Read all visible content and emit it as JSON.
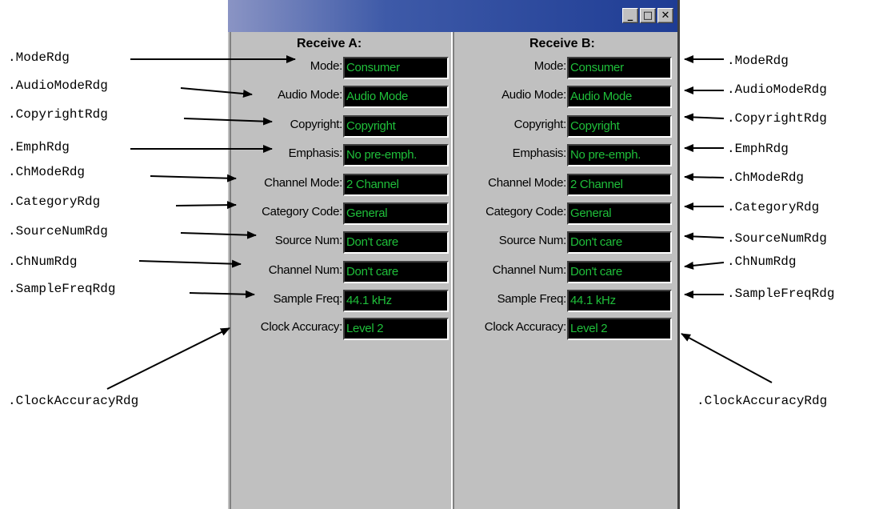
{
  "window": {
    "controls": {
      "minimize": "_",
      "maximize": "□",
      "close": "✕"
    }
  },
  "receive_a": {
    "header": "Receive A:",
    "fields": [
      {
        "label": "Mode:",
        "value": "Consumer"
      },
      {
        "label": "Audio Mode:",
        "value": "Audio Mode"
      },
      {
        "label": "Copyright:",
        "value": "Copyright"
      },
      {
        "label": "Emphasis:",
        "value": "No pre-emph."
      },
      {
        "label": "Channel Mode:",
        "value": "2 Channel"
      },
      {
        "label": "Category Code:",
        "value": "General"
      },
      {
        "label": "Source Num:",
        "value": "Don't care"
      },
      {
        "label": "Channel Num:",
        "value": "Don't care"
      },
      {
        "label": "Sample Freq:",
        "value": "44.1 kHz"
      },
      {
        "label": "Clock Accuracy:",
        "value": "Level 2"
      }
    ]
  },
  "receive_b": {
    "header": "Receive B:",
    "fields": [
      {
        "label": "Mode:",
        "value": "Consumer"
      },
      {
        "label": "Audio Mode:",
        "value": "Audio Mode"
      },
      {
        "label": "Copyright:",
        "value": "Copyright"
      },
      {
        "label": "Emphasis:",
        "value": "No pre-emph."
      },
      {
        "label": "Channel Mode:",
        "value": "2 Channel"
      },
      {
        "label": "Category Code:",
        "value": "General"
      },
      {
        "label": "Source Num:",
        "value": "Don't care"
      },
      {
        "label": "Channel Num:",
        "value": "Don't care"
      },
      {
        "label": "Sample Freq:",
        "value": "44.1 kHz"
      },
      {
        "label": "Clock Accuracy:",
        "value": "Level 2"
      }
    ]
  },
  "annotations": {
    "left": [
      ".ModeRdg",
      ".AudioModeRdg",
      ".CopyrightRdg",
      ".EmphRdg",
      ".ChModeRdg",
      ".CategoryRdg",
      ".SourceNumRdg",
      ".ChNumRdg",
      ".SampleFreqRdg",
      ".ClockAccuracyRdg"
    ],
    "right": [
      ".ModeRdg",
      ".AudioModeRdg",
      ".CopyrightRdg",
      ".EmphRdg",
      ".ChModeRdg",
      ".CategoryRdg",
      ".SourceNumRdg",
      ".ChNumRdg",
      ".SampleFreqRdg",
      ".ClockAccuracyRdg"
    ]
  },
  "colors": {
    "reading_text": "#1fbf3a",
    "reading_bg": "#000000",
    "panel_bg": "#c0c0c0",
    "titlebar_start": "#8a94c4",
    "titlebar_end": "#1e3c94"
  }
}
